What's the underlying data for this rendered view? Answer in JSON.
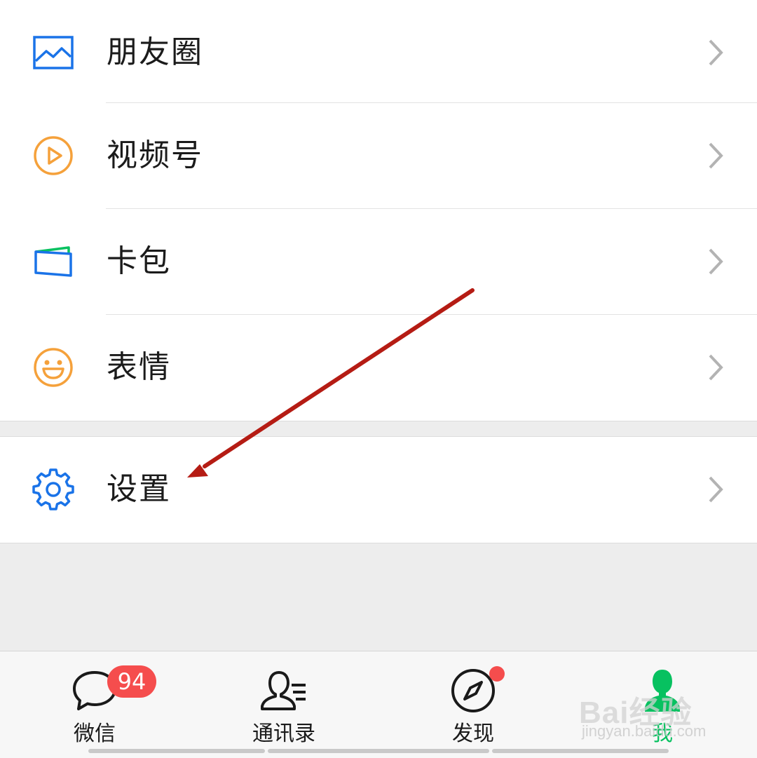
{
  "menu": {
    "items": [
      {
        "label": "朋友圈",
        "icon": "moments-icon"
      },
      {
        "label": "视频号",
        "icon": "channels-play-icon"
      },
      {
        "label": "卡包",
        "icon": "card-wallet-icon"
      },
      {
        "label": "表情",
        "icon": "sticker-smile-icon"
      }
    ],
    "settings": {
      "label": "设置",
      "icon": "gear-icon"
    }
  },
  "tabbar": {
    "tabs": [
      {
        "label": "微信",
        "icon": "chat-bubble-icon",
        "badge": "94"
      },
      {
        "label": "通讯录",
        "icon": "contacts-icon"
      },
      {
        "label": "发现",
        "icon": "compass-icon",
        "dot": true
      },
      {
        "label": "我",
        "icon": "me-person-icon",
        "active": true
      }
    ]
  },
  "colors": {
    "blue_icon": "#1a73e8",
    "orange_icon": "#f5a13b",
    "active_green": "#07c160",
    "badge_red": "#f54d4d",
    "annotation_arrow": "#b51c14"
  },
  "watermark": {
    "logo": "Bai经验",
    "url": "jingyan.baidu.com"
  }
}
